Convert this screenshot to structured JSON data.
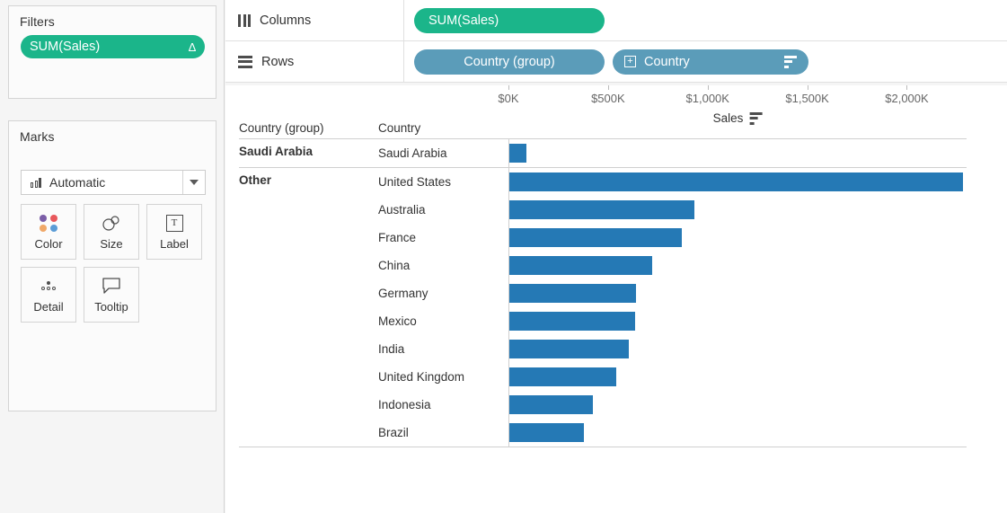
{
  "filters": {
    "title": "Filters",
    "pill": {
      "label": "SUM(Sales)",
      "icon": "delta-icon",
      "glyph": "∆",
      "color": "#1bb58a"
    }
  },
  "marks": {
    "title": "Marks",
    "type_selector": {
      "label": "Automatic",
      "icon": "bar-mark-icon",
      "caret": "chevron-down-icon"
    },
    "buttons": [
      {
        "label": "Color",
        "icon": "color-dots-icon"
      },
      {
        "label": "Size",
        "icon": "size-circles-icon"
      },
      {
        "label": "Label",
        "icon": "label-text-icon",
        "glyph": "T"
      },
      {
        "label": "Detail",
        "icon": "detail-dots-icon"
      },
      {
        "label": "Tooltip",
        "icon": "tooltip-bubble-icon"
      }
    ],
    "color_swatches": [
      "#7b5ea7",
      "#e8585c",
      "#f0a868",
      "#5b9cd6"
    ]
  },
  "shelves": [
    {
      "name": "Columns",
      "icon": "columns-icon",
      "pills": [
        {
          "label": "SUM(Sales)",
          "color": "#1bb58a",
          "type": "green"
        }
      ]
    },
    {
      "name": "Rows",
      "icon": "rows-icon",
      "pills": [
        {
          "label": "Country (group)",
          "color": "#5b9cb9",
          "type": "blue"
        },
        {
          "label": "Country",
          "color": "#5b9cb9",
          "type": "blue",
          "expand_icon": "plus-box-icon",
          "sort_icon": "sort-icon"
        }
      ]
    }
  ],
  "viz": {
    "column_headers": [
      "Country (group)",
      "Country"
    ],
    "axis_title": "Sales",
    "axis_sort_icon": "sort-icon"
  },
  "chart_data": {
    "type": "bar",
    "title": "",
    "xlabel": "Sales",
    "ylabel": "",
    "orientation": "horizontal",
    "xlim": [
      0,
      2300
    ],
    "ticks": [
      {
        "value": 0,
        "label": "$0K"
      },
      {
        "value": 500,
        "label": "$500K"
      },
      {
        "value": 1000,
        "label": "$1,000K"
      },
      {
        "value": 1500,
        "label": "$1,500K"
      },
      {
        "value": 2000,
        "label": "$2,000K"
      }
    ],
    "grid": false,
    "legend": "none",
    "bar_color": "#2579b5",
    "value_units": "thousands of dollars",
    "groups": [
      {
        "group": "Saudi Arabia",
        "rows": [
          {
            "category": "Saudi Arabia",
            "value": 86
          }
        ]
      },
      {
        "group": "Other",
        "rows": [
          {
            "category": "United States",
            "value": 2277
          },
          {
            "category": "Australia",
            "value": 927
          },
          {
            "category": "France",
            "value": 864
          },
          {
            "category": "China",
            "value": 718
          },
          {
            "category": "Germany",
            "value": 636
          },
          {
            "category": "Mexico",
            "value": 632
          },
          {
            "category": "India",
            "value": 600
          },
          {
            "category": "United Kingdom",
            "value": 536
          },
          {
            "category": "Indonesia",
            "value": 418
          },
          {
            "category": "Brazil",
            "value": 373
          }
        ]
      }
    ]
  }
}
